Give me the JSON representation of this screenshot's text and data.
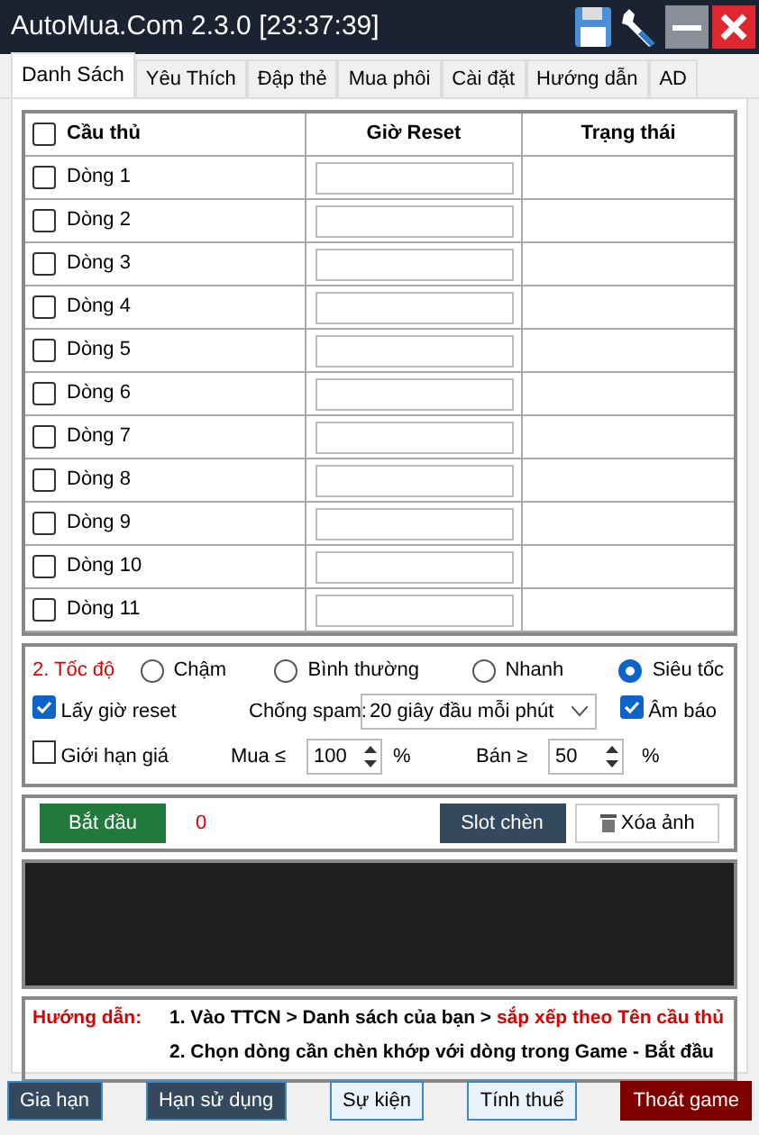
{
  "window": {
    "title": "AutoMua.Com 2.3.0 [23:37:39]"
  },
  "tabs": [
    {
      "label": "Danh Sách",
      "selected": true
    },
    {
      "label": "Yêu Thích",
      "selected": false
    },
    {
      "label": "Đập thẻ",
      "selected": false
    },
    {
      "label": "Mua phôi",
      "selected": false
    },
    {
      "label": "Cài đặt",
      "selected": false
    },
    {
      "label": "Hướng dẫn",
      "selected": false
    },
    {
      "label": "AD",
      "selected": false
    }
  ],
  "table": {
    "select_all": {
      "label": "Cầu thủ",
      "checked": false
    },
    "columns": [
      "Giờ Reset",
      "Trạng thái"
    ],
    "rows": [
      {
        "label": "Dòng 1",
        "checked": false
      },
      {
        "label": "Dòng 2",
        "checked": false
      },
      {
        "label": "Dòng 3",
        "checked": false
      },
      {
        "label": "Dòng 4",
        "checked": false
      },
      {
        "label": "Dòng 5",
        "checked": false
      },
      {
        "label": "Dòng 6",
        "checked": false
      },
      {
        "label": "Dòng 7",
        "checked": false
      },
      {
        "label": "Dòng 8",
        "checked": false
      },
      {
        "label": "Dòng 9",
        "checked": false
      },
      {
        "label": "Dòng 10",
        "checked": false
      },
      {
        "label": "Dòng 11",
        "checked": false
      }
    ]
  },
  "speed": {
    "label": "2. Tốc độ",
    "options": [
      {
        "label": "Chậm",
        "selected": false
      },
      {
        "label": "Bình thường",
        "selected": false
      },
      {
        "label": "Nhanh",
        "selected": false
      },
      {
        "label": "Siêu tốc",
        "selected": true
      }
    ]
  },
  "reset_time": {
    "label": "Lấy giờ reset",
    "checked": true
  },
  "anti_spam": {
    "label": "Chống spam:",
    "value": "20 giây đầu mỗi phút"
  },
  "sound": {
    "label": "Âm báo",
    "checked": true
  },
  "price_limit": {
    "label": "Giới hạn giá",
    "checked": false
  },
  "buy": {
    "label": "Mua ≤",
    "value": "100",
    "unit": "%"
  },
  "sell": {
    "label": "Bán ≥",
    "value": "50",
    "unit": "%"
  },
  "actions": {
    "start": "Bắt đầu",
    "counter": "0",
    "slot": "Slot chèn",
    "clear": "Xóa ảnh"
  },
  "guide": {
    "label": "Hướng dẫn:",
    "lines": [
      [
        {
          "text": "1.  Vào TTCN > Danh sách của bạn > ",
          "highlight": false
        },
        {
          "text": "sắp xếp theo Tên cầu thủ",
          "highlight": true
        }
      ],
      [
        {
          "text": "2. Chọn dòng cần chèn khớp với dòng trong Game - Bắt đầu",
          "highlight": false
        }
      ]
    ]
  },
  "footer": [
    {
      "label": "Gia hạn",
      "kind": "dark"
    },
    {
      "label": "Hạn sử dụng",
      "kind": "dark"
    },
    {
      "label": "Sự kiện",
      "kind": "light"
    },
    {
      "label": "Tính thuế",
      "kind": "light"
    },
    {
      "label": "Thoát game",
      "kind": "exit"
    }
  ]
}
